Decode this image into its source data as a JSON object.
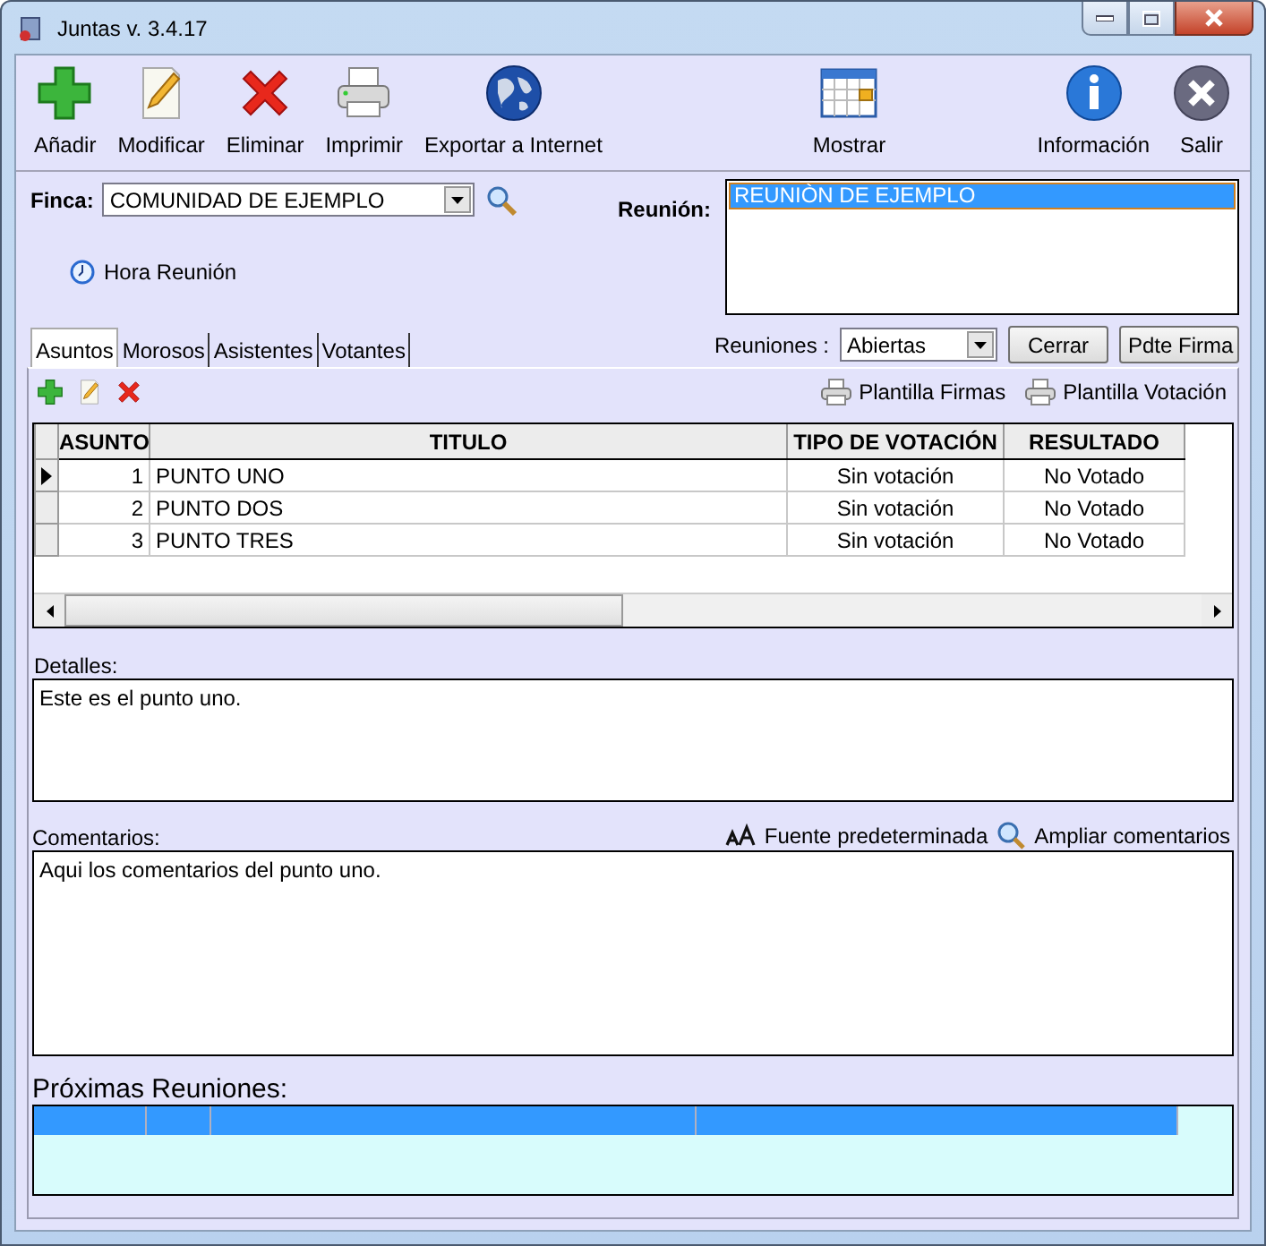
{
  "window": {
    "title": "Juntas v. 3.4.17"
  },
  "toolbar": {
    "left": [
      {
        "label": "Añadir",
        "kind": "add"
      },
      {
        "label": "Modificar",
        "kind": "edit"
      },
      {
        "label": "Eliminar",
        "kind": "delete"
      },
      {
        "label": "Imprimir",
        "kind": "print"
      },
      {
        "label": "Exportar a Internet",
        "kind": "globe"
      }
    ],
    "center": [
      {
        "label": "Mostrar",
        "kind": "calendar"
      }
    ],
    "right": [
      {
        "label": "Información",
        "kind": "info"
      },
      {
        "label": "Salir",
        "kind": "exit"
      }
    ]
  },
  "finca": {
    "label": "Finca:",
    "value": "COMUNIDAD DE EJEMPLO"
  },
  "hora_reunion": "Hora Reunión",
  "reunion": {
    "label": "Reunión:",
    "items": [
      {
        "text": "REUNIÒN DE EJEMPLO",
        "selected": true
      }
    ]
  },
  "reuniones_filter": {
    "label": "Reuniones :",
    "value": "Abiertas"
  },
  "buttons": [
    "Cerrar",
    "Pdte Firma"
  ],
  "tabs": [
    {
      "label": "Asuntos",
      "selected": true
    },
    {
      "label": "Morosos",
      "selected": false
    },
    {
      "label": "Asistentes",
      "selected": false
    },
    {
      "label": "Votantes",
      "selected": false
    }
  ],
  "asuntos": {
    "tools": [
      {
        "kind": "add"
      },
      {
        "kind": "edit"
      },
      {
        "kind": "delete"
      }
    ],
    "templates": [
      "Plantilla Firmas",
      "Plantilla Votación"
    ],
    "table": {
      "columns": [
        "ASUNTO",
        "TITULO",
        "TIPO DE VOTACIÓN",
        "RESULTADO"
      ],
      "rows": [
        {
          "cells": [
            "1",
            "PUNTO UNO",
            "Sin votación",
            "No Votado"
          ],
          "selected": true
        },
        {
          "cells": [
            "2",
            "PUNTO DOS",
            "Sin votación",
            "No Votado"
          ],
          "selected": false
        },
        {
          "cells": [
            "3",
            "PUNTO TRES",
            "Sin votación",
            "No Votado"
          ],
          "selected": false
        }
      ]
    }
  },
  "detalles": {
    "label": "Detalles:",
    "value": "Este es el punto uno."
  },
  "comentarios": {
    "label": "Comentarios:",
    "value": "Aqui los comentarios del punto uno.",
    "actions": [
      {
        "label": "Fuente predeterminada",
        "kind": "font"
      },
      {
        "label": "Ampliar comentarios",
        "kind": "zoom"
      }
    ]
  },
  "proximas": {
    "title": "Próximas Reuniones:"
  }
}
